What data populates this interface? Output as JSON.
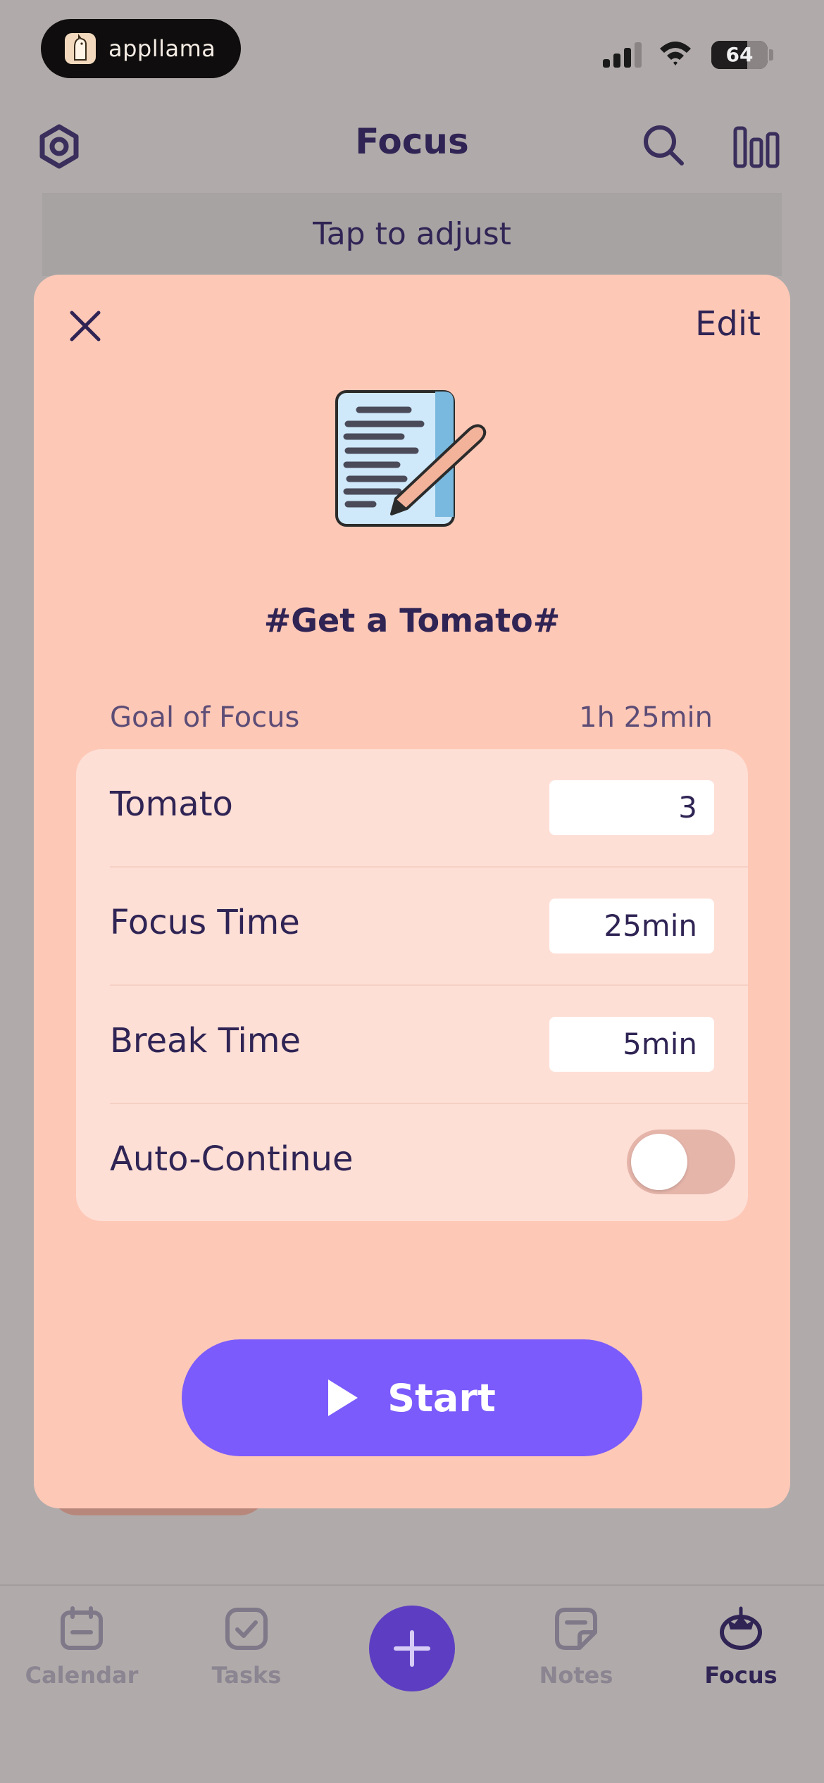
{
  "status_bar": {
    "app_badge_label": "appllama",
    "battery_level": "64"
  },
  "header": {
    "title": "Focus",
    "adjust_hint": "Tap to adjust"
  },
  "sheet": {
    "edit_label": "Edit",
    "session_title": "#Get a Tomato#",
    "goal_label": "Goal of Focus",
    "goal_value": "1h 25min",
    "rows": [
      {
        "label": "Tomato",
        "value": "3"
      },
      {
        "label": "Focus Time",
        "value": "25min"
      },
      {
        "label": "Break Time",
        "value": "5min"
      }
    ],
    "auto_continue": {
      "label": "Auto-Continue",
      "enabled": false
    },
    "start_label": "Start"
  },
  "tabbar": {
    "tabs": [
      {
        "label": "Calendar",
        "icon": "calendar-icon"
      },
      {
        "label": "Tasks",
        "icon": "checkbox-icon"
      },
      {
        "label": "Notes",
        "icon": "note-icon"
      },
      {
        "label": "Focus",
        "icon": "tomato-icon"
      }
    ],
    "active": "Focus"
  },
  "colors": {
    "sheet_bg": "#fec8b7",
    "card_bg": "#fedfd6",
    "accent": "#7b5bfb",
    "text": "#2f2454",
    "add_button": "#5d3ec2"
  }
}
